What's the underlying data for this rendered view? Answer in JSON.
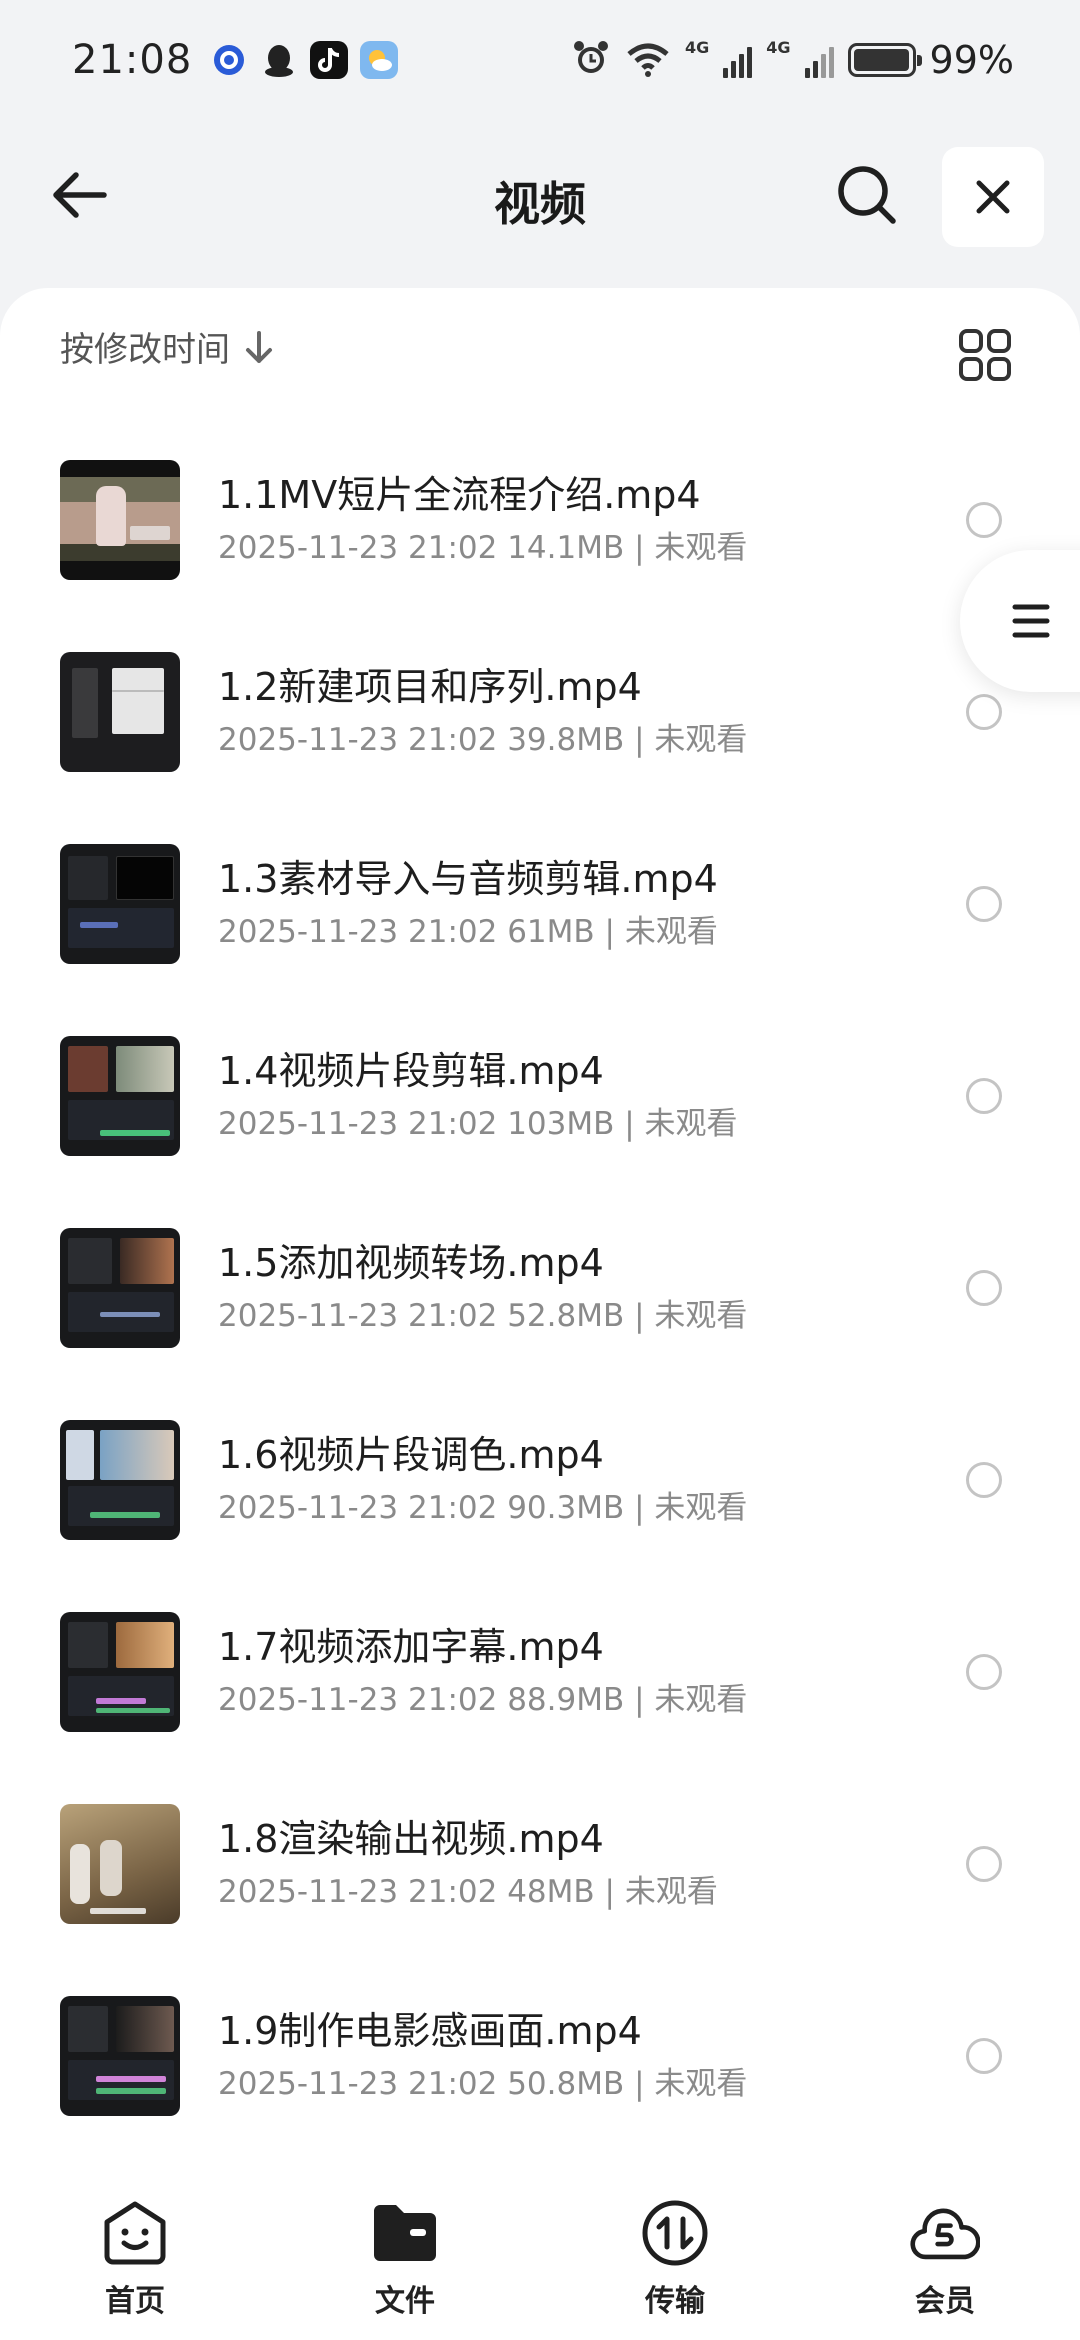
{
  "status_bar": {
    "time": "21:08",
    "net_label_1": "4G",
    "net_label_2": "4G",
    "battery": "99%",
    "battery_level": 0.99
  },
  "header": {
    "title": "视频"
  },
  "sort": {
    "label": "按修改时间"
  },
  "files": [
    {
      "name": "1.1MV短片全流程介绍.mp4",
      "meta": "2025-11-23 21:02  14.1MB | 未观看"
    },
    {
      "name": "1.2新建项目和序列.mp4",
      "meta": "2025-11-23 21:02  39.8MB | 未观看"
    },
    {
      "name": "1.3素材导入与音频剪辑.mp4",
      "meta": "2025-11-23 21:02  61MB | 未观看"
    },
    {
      "name": "1.4视频片段剪辑.mp4",
      "meta": "2025-11-23 21:02  103MB | 未观看"
    },
    {
      "name": "1.5添加视频转场.mp4",
      "meta": "2025-11-23 21:02  52.8MB | 未观看"
    },
    {
      "name": "1.6视频片段调色.mp4",
      "meta": "2025-11-23 21:02  90.3MB | 未观看"
    },
    {
      "name": "1.7视频添加字幕.mp4",
      "meta": "2025-11-23 21:02  88.9MB | 未观看"
    },
    {
      "name": "1.8渲染输出视频.mp4",
      "meta": "2025-11-23 21:02  48MB | 未观看"
    },
    {
      "name": "1.9制作电影感画面.mp4",
      "meta": "2025-11-23 21:02  50.8MB | 未观看"
    }
  ],
  "nav": [
    {
      "label": "首页",
      "icon": "smile-face-icon"
    },
    {
      "label": "文件",
      "icon": "folder-icon"
    },
    {
      "label": "传输",
      "icon": "transfer-icon"
    },
    {
      "label": "会员",
      "icon": "cloud-vip-icon"
    }
  ]
}
